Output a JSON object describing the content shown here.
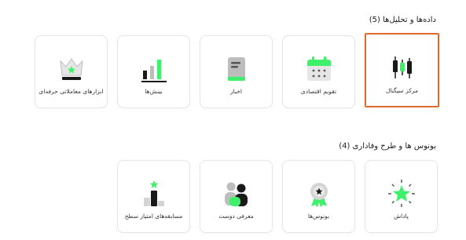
{
  "section1": {
    "title": "داده‌ها و تحلیل‌ها (5)",
    "cards": [
      {
        "label": "مرکز سیگنال",
        "icon": "candlestick-icon",
        "selected": true
      },
      {
        "label": "تقویم اقتصادی",
        "icon": "calendar-icon",
        "selected": false
      },
      {
        "label": "اخبار",
        "icon": "news-icon",
        "selected": false
      },
      {
        "label": "بینش‌ها",
        "icon": "bar-chart-icon",
        "selected": false
      },
      {
        "label": "ابزارهای معاملاتی حرفه‌ای",
        "icon": "crown-icon",
        "selected": false
      }
    ]
  },
  "section2": {
    "title": "بونوس ها و طرح وفاداری (4)",
    "cards": [
      {
        "label": "پاداش",
        "icon": "star-burst-icon"
      },
      {
        "label": "بونوس‌ها",
        "icon": "medal-icon"
      },
      {
        "label": "معرفی دوست",
        "icon": "friends-icon"
      },
      {
        "label": "مسابقه‌های امتیاز سطح",
        "icon": "podium-icon"
      }
    ]
  },
  "colors": {
    "accent": "#3ef06a",
    "selected_border": "#e06a2a",
    "icon_dark": "#1a1a1a",
    "icon_gray": "#bdbdbd"
  }
}
